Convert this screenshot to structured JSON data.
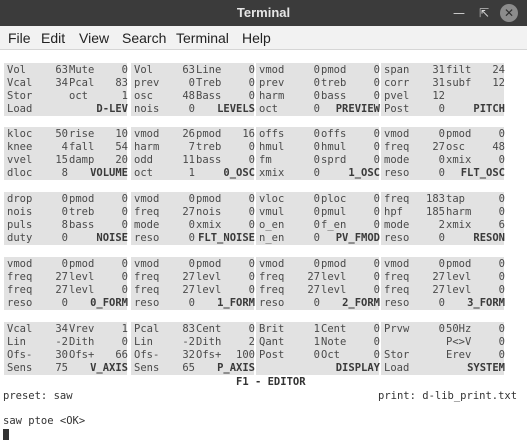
{
  "window": {
    "title": "Terminal"
  },
  "menu": [
    "File",
    "Edit",
    "View",
    "Search",
    "Terminal",
    "Help"
  ],
  "footer": {
    "screen_title": "F1 - EDITOR",
    "preset_label": "preset: saw",
    "print_label": "print: d-lib_print.txt",
    "prompt": "saw ptoe <OK>"
  },
  "panels": [
    {
      "rows": [
        [
          "Vol",
          "63",
          "Mute",
          "0",
          "Vol",
          "63",
          "Line",
          "0",
          "vmod",
          "0",
          "pmod",
          "0",
          "span",
          "31",
          "filt",
          "24"
        ],
        [
          "Vcal",
          "34",
          "Pcal",
          "83",
          "prev",
          "0",
          "Treb",
          "0",
          "prev",
          "0",
          "treb",
          "0",
          "corr",
          "31",
          "subf",
          "12"
        ],
        [
          "Stor",
          "",
          "oct",
          "1",
          "osc",
          "48",
          "Bass",
          "0",
          "harm",
          "0",
          "bass",
          "0",
          "pvel",
          "12",
          "",
          ""
        ],
        [
          "Load",
          "",
          "",
          "D-LEV",
          "nois",
          "0",
          "",
          "LEVELS",
          "oct",
          "0",
          "",
          "PREVIEW",
          "Post",
          "0",
          "",
          "PITCH"
        ]
      ]
    },
    {
      "rows": [
        [
          "kloc",
          "50",
          "rise",
          "10",
          "vmod",
          "26",
          "pmod",
          "16",
          "offs",
          "0",
          "offs",
          "0",
          "vmod",
          "0",
          "pmod",
          "0"
        ],
        [
          "knee",
          "4",
          "fall",
          "54",
          "harm",
          "7",
          "treb",
          "0",
          "hmul",
          "0",
          "hmul",
          "0",
          "freq",
          "27",
          "osc",
          "48"
        ],
        [
          "vvel",
          "15",
          "damp",
          "20",
          "odd",
          "11",
          "bass",
          "0",
          "fm",
          "0",
          "sprd",
          "0",
          "mode",
          "0",
          "xmix",
          "0"
        ],
        [
          "dloc",
          "8",
          "",
          "VOLUME",
          "oct",
          "1",
          "",
          "0_OSC",
          "xmix",
          "0",
          "",
          "1_OSC",
          "reso",
          "0",
          "",
          "FLT_OSC"
        ]
      ]
    },
    {
      "rows": [
        [
          "drop",
          "0",
          "pmod",
          "0",
          "vmod",
          "0",
          "pmod",
          "0",
          "vloc",
          "0",
          "ploc",
          "0",
          "freq",
          "183",
          "tap",
          "0"
        ],
        [
          "nois",
          "0",
          "treb",
          "0",
          "freq",
          "27",
          "nois",
          "0",
          "vmul",
          "0",
          "pmul",
          "0",
          "hpf",
          "185",
          "harm",
          "0"
        ],
        [
          "puls",
          "8",
          "bass",
          "0",
          "mode",
          "0",
          "xmix",
          "0",
          "o_en",
          "0",
          "f_en",
          "0",
          "mode",
          "2",
          "xmix",
          "6"
        ],
        [
          "duty",
          "0",
          "",
          "NOISE",
          "reso",
          "0",
          "",
          "FLT_NOISE",
          "n_en",
          "0",
          "",
          "PV_FMOD",
          "reso",
          "0",
          "",
          "RESON"
        ]
      ]
    },
    {
      "rows": [
        [
          "vmod",
          "0",
          "pmod",
          "0",
          "vmod",
          "0",
          "pmod",
          "0",
          "vmod",
          "0",
          "pmod",
          "0",
          "vmod",
          "0",
          "pmod",
          "0"
        ],
        [
          "freq",
          "27",
          "levl",
          "0",
          "freq",
          "27",
          "levl",
          "0",
          "freq",
          "27",
          "levl",
          "0",
          "freq",
          "27",
          "levl",
          "0"
        ],
        [
          "freq",
          "27",
          "levl",
          "0",
          "freq",
          "27",
          "levl",
          "0",
          "freq",
          "27",
          "levl",
          "0",
          "freq",
          "27",
          "levl",
          "0"
        ],
        [
          "reso",
          "0",
          "",
          "0_FORM",
          "reso",
          "0",
          "",
          "1_FORM",
          "reso",
          "0",
          "",
          "2_FORM",
          "reso",
          "0",
          "",
          "3_FORM"
        ]
      ]
    },
    {
      "rows": [
        [
          "Vcal",
          "34",
          "Vrev",
          "1",
          "Pcal",
          "83",
          "Cent",
          "0",
          "Brit",
          "1",
          "Cent",
          "0",
          "Prvw",
          "0",
          "50Hz",
          "0"
        ],
        [
          "Lin",
          "-2",
          "Dith",
          "0",
          "Lin",
          "-2",
          "Dith",
          "2",
          "Qant",
          "1",
          "Note",
          "0",
          "",
          "",
          "P<>V",
          "0"
        ],
        [
          "Ofs-",
          "30",
          "Ofs+",
          "66",
          "Ofs-",
          "32",
          "Ofs+",
          "100",
          "Post",
          "0",
          "Oct",
          "0",
          "Stor",
          "",
          "Erev",
          "0"
        ],
        [
          "Sens",
          "75",
          "",
          "V_AXIS",
          "Sens",
          "65",
          "",
          "P_AXIS",
          "",
          "",
          "",
          "DISPLAY",
          "Load",
          "",
          "",
          "SYSTEM"
        ]
      ]
    }
  ]
}
